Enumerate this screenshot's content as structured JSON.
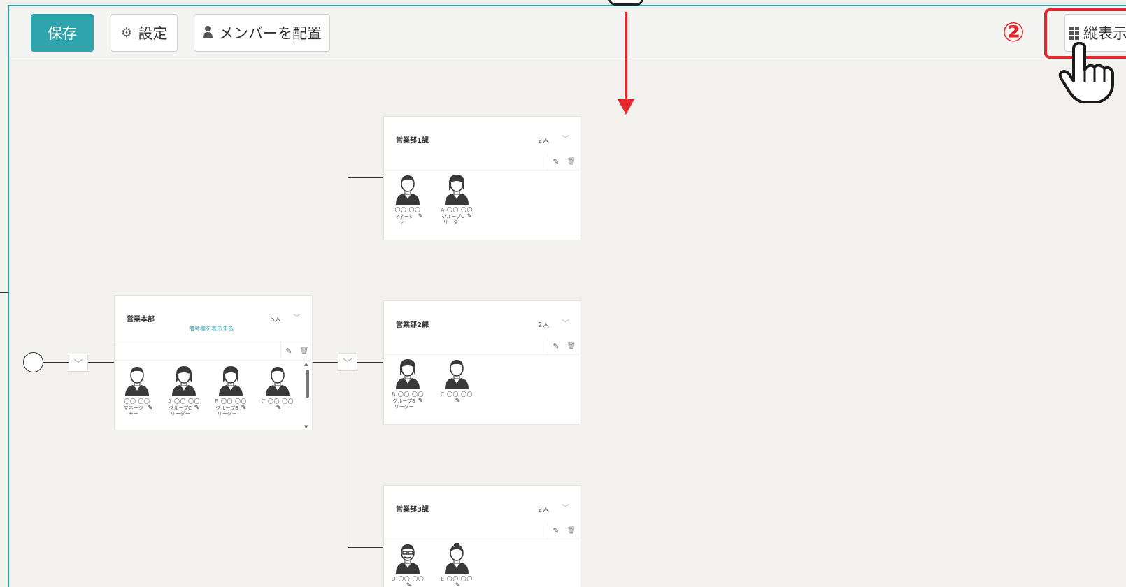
{
  "toolbar": {
    "save_label": "保存",
    "settings_label": "設定",
    "assign_label": "メンバーを配置",
    "vertical_label": "縦表示"
  },
  "annotation": {
    "step_number": "②",
    "accent_color": "#e5262a"
  },
  "colors": {
    "primary": "#2ea4ad",
    "highlight": "#e5262a",
    "canvas": "#f2f1ee"
  },
  "org": {
    "root": {
      "name": "営業本部",
      "count": "6人",
      "memo_link": "備考欄を表示する",
      "members": [
        {
          "name": "〇〇 〇〇",
          "role": "マネージャー",
          "avatar": "male"
        },
        {
          "name": "A 〇〇 〇〇",
          "role": "グループCリーダー",
          "avatar": "female"
        },
        {
          "name": "B 〇〇 〇〇",
          "role": "グループBリーダー",
          "avatar": "female-alt"
        },
        {
          "name": "C 〇〇 〇〇",
          "role": "",
          "avatar": "male-alt"
        }
      ]
    },
    "children": [
      {
        "name": "営業部1課",
        "count": "2人",
        "members": [
          {
            "name": "〇〇 〇〇",
            "role": "マネージャー",
            "avatar": "male"
          },
          {
            "name": "A 〇〇 〇〇",
            "role": "グループCリーダー",
            "avatar": "female"
          }
        ]
      },
      {
        "name": "営業部2課",
        "count": "2人",
        "members": [
          {
            "name": "B 〇〇 〇〇",
            "role": "グループBリーダー",
            "avatar": "female-alt"
          },
          {
            "name": "C 〇〇 〇〇",
            "role": "",
            "avatar": "male-alt"
          }
        ]
      },
      {
        "name": "営業部3課",
        "count": "2人",
        "members": [
          {
            "name": "D 〇〇 〇〇",
            "role": "",
            "avatar": "male-glasses"
          },
          {
            "name": "E 〇〇 〇〇",
            "role": "",
            "avatar": "female-bun"
          }
        ]
      }
    ]
  }
}
